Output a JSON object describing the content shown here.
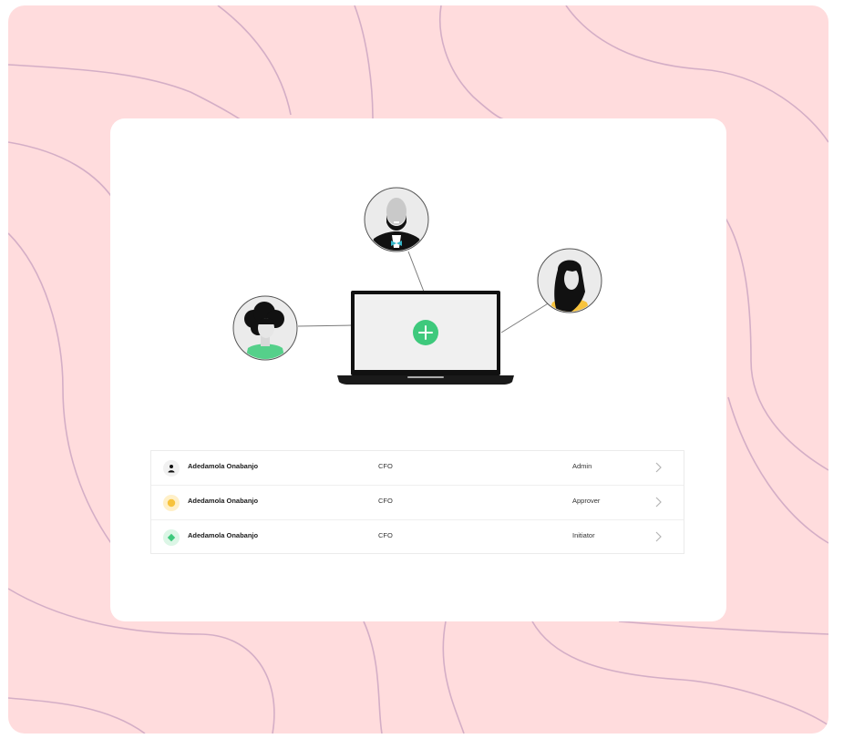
{
  "colors": {
    "background": "#ffdcdd",
    "wave_stroke": "#d4aec6",
    "card": "#ffffff",
    "accent_green": "#3ec97c",
    "avatar_yellow": "#f7c33d",
    "avatar_green": "#55d08a"
  },
  "illustration": {
    "center_device": "laptop-icon",
    "center_action": "plus-icon",
    "avatars": [
      {
        "icon": "man-avatar-icon",
        "shirt": "bowtie"
      },
      {
        "icon": "woman-afro-avatar-icon",
        "shirt": "green"
      },
      {
        "icon": "woman-longhair-avatar-icon",
        "shirt": "yellow"
      }
    ]
  },
  "users": [
    {
      "name": "Adedamola Onabanjo",
      "title": "CFO",
      "role": "Admin",
      "icon": "person-icon"
    },
    {
      "name": "Adedamola Onabanjo",
      "title": "CFO",
      "role": "Approver",
      "icon": "yellow-dot-icon"
    },
    {
      "name": "Adedamola Onabanjo",
      "title": "CFO",
      "role": "Initiator",
      "icon": "green-diamond-icon"
    }
  ]
}
